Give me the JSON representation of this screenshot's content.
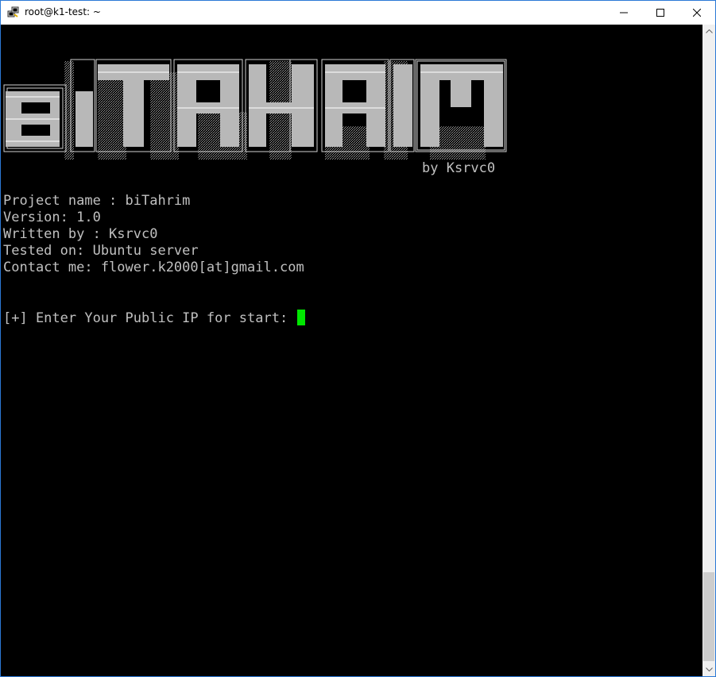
{
  "window": {
    "title": "root@k1-test: ~",
    "controls": {
      "minimize": "minimize",
      "maximize": "maximize",
      "close": "close"
    }
  },
  "banner": {
    "letters": [
      "b",
      "i",
      "T",
      "A",
      "H",
      "R",
      "I",
      "M"
    ],
    "byline": "by Ksrvc0"
  },
  "info": {
    "project": "Project name : biTahrim",
    "version": "Version: 1.0",
    "author": "Written by : Ksrvc0",
    "tested": "Tested on: Ubuntu server",
    "contact": "Contact me: flower.k2000[at]gmail.com"
  },
  "prompt": {
    "text": "[+] Enter Your Public IP for start: "
  },
  "colors": {
    "terminal_bg": "#000000",
    "text": "#c0c0c0",
    "cursor": "#00e600",
    "banner_fill": "#b8b8b8"
  }
}
